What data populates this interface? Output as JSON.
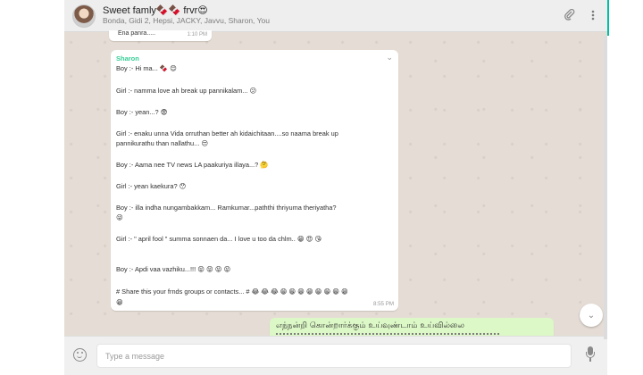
{
  "header": {
    "title": "Sweet famly🍫🍫 frvr😍",
    "members": "Bonda, Gidi 2, Hepsi, JACKY, Javvu, Sharon, You",
    "attach_icon": "paperclip-icon",
    "menu_icon": "kebab-menu-icon"
  },
  "previous_message": {
    "text": "Ena panra.....",
    "time": "1:10 PM"
  },
  "message": {
    "sender": "Sharon",
    "lines": [
      "Boy :-    Hi ma... 🍫 😊",
      "Girl :-    namma love ah break up pannikalam... 😕",
      "Boy :-     yean...? 😨",
      "Girl :-    enaku unna Vida orruthan better ah kidaichitaan....so naama break up",
      "pannikurathu than nallathu... 😒",
      "Boy :-  Aama nee TV news LA paakuriya illaya...? 🤔",
      "Girl :- yean kaekura? 😯",
      "Boy :- illa indha nungambakkam... Ramkumar...paththi thriyuma theriyatha?",
      "😜",
      "Girl :- \" april fool \" summa sonnaen da... I love u too da chlm.. 😁 😍 😘",
      "Boy :- Apdi vaa vazhiku...!!! 😝 😝 😝 😝",
      "# Share this your frnds groups or contacts... # 😂 😂 😂 😁 😁 😁 😁 😁 😁 😁 😁",
      "😁"
    ],
    "time": "8:55 PM"
  },
  "outgoing": {
    "text": "எந்நன்றி கொன்றார்க்கும் உய்வுண்டாம் உய்வில்லை"
  },
  "composer": {
    "placeholder": "Type a message",
    "emoji_icon": "emoji-icon",
    "mic_icon": "microphone-icon"
  },
  "colors": {
    "sender": "#35cd96",
    "chat_bg": "#e5ddd5",
    "outgoing_bg": "#dcf8c6"
  }
}
